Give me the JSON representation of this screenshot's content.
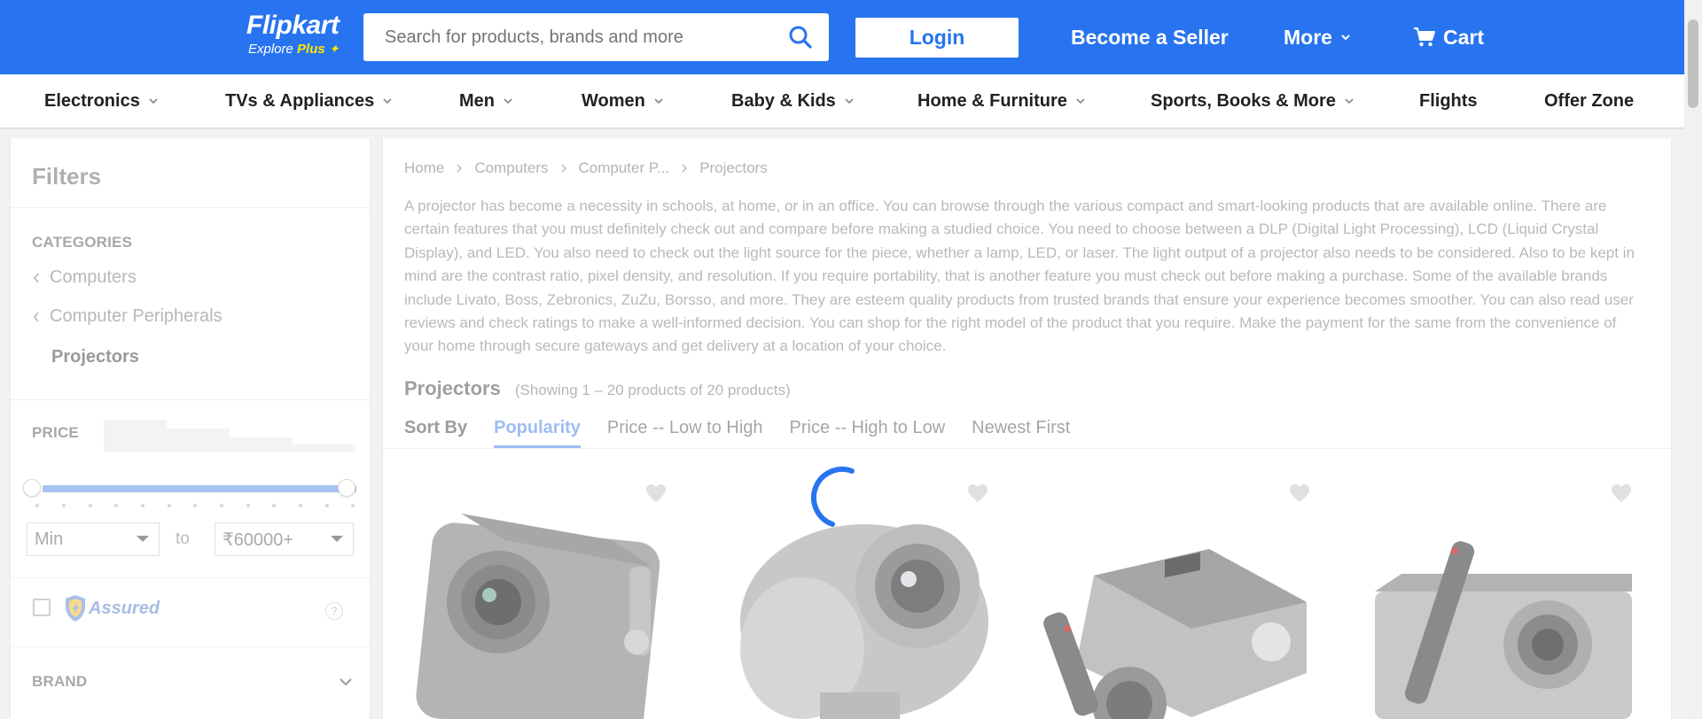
{
  "header": {
    "logo_brand": "Flipkart",
    "logo_tag_prefix": "Explore",
    "logo_tag_plus": "Plus",
    "search_placeholder": "Search for products, brands and more",
    "login_label": "Login",
    "seller_label": "Become a Seller",
    "more_label": "More",
    "cart_label": "Cart"
  },
  "nav": {
    "items": [
      {
        "label": "Electronics"
      },
      {
        "label": "TVs & Appliances"
      },
      {
        "label": "Men"
      },
      {
        "label": "Women"
      },
      {
        "label": "Baby & Kids"
      },
      {
        "label": "Home & Furniture"
      },
      {
        "label": "Sports, Books & More"
      },
      {
        "label": "Flights"
      },
      {
        "label": "Offer Zone"
      }
    ]
  },
  "filters": {
    "title": "Filters",
    "categories_heading": "CATEGORIES",
    "category_links": [
      "Computers",
      "Computer Peripherals"
    ],
    "current_category": "Projectors",
    "price_heading": "PRICE",
    "price_min": "Min",
    "price_to": "to",
    "price_max": "₹60000+",
    "assured_label": "Assured",
    "help_label": "?",
    "brand_heading": "BRAND"
  },
  "main": {
    "breadcrumbs": [
      "Home",
      "Computers",
      "Computer P...",
      "Projectors"
    ],
    "description": "A projector has become a necessity in schools, at home, or in an office. You can browse through the various compact and smart-looking products that are available online. There are certain features that you must definitely check out and compare before making a studied choice. You need to choose between a DLP (Digital Light Processing), LCD (Liquid Crystal Display), and LED. You also need to check out the light source for the piece, whether a lamp, LED, or laser. The light output of a projector also needs to be considered. Also to be kept in mind are the contrast ratio, pixel density, and resolution. If you require portability, that is another feature you must check out before making a purchase. Some of the available brands include Livato, Boss, Zebronics, ZuZu, Borsso, and more. They are esteem quality products from trusted brands that ensure your experience becomes smoother. You can also read user reviews and check ratings to make a well-informed decision. You can shop for the right model of the product that you require. Make the payment for the same from the convenience of your home through secure gateways and get delivery at a location of your choice.",
    "title": "Projectors",
    "showing": "(Showing 1 – 20 products of 20 products)",
    "sort_label": "Sort By",
    "sort_options": [
      "Popularity",
      "Price -- Low to High",
      "Price -- High to Low",
      "Newest First"
    ],
    "active_sort": "Popularity"
  },
  "colors": {
    "brand_blue": "#2874f0",
    "plus_yellow": "#ffe500",
    "spinner_blue": "#2874f0"
  },
  "icons": [
    "search-icon",
    "chevron-down-icon",
    "cart-icon",
    "chevron-left-icon",
    "chevron-right-icon",
    "heart-icon",
    "assured-shield-icon",
    "loading-spinner-icon"
  ]
}
